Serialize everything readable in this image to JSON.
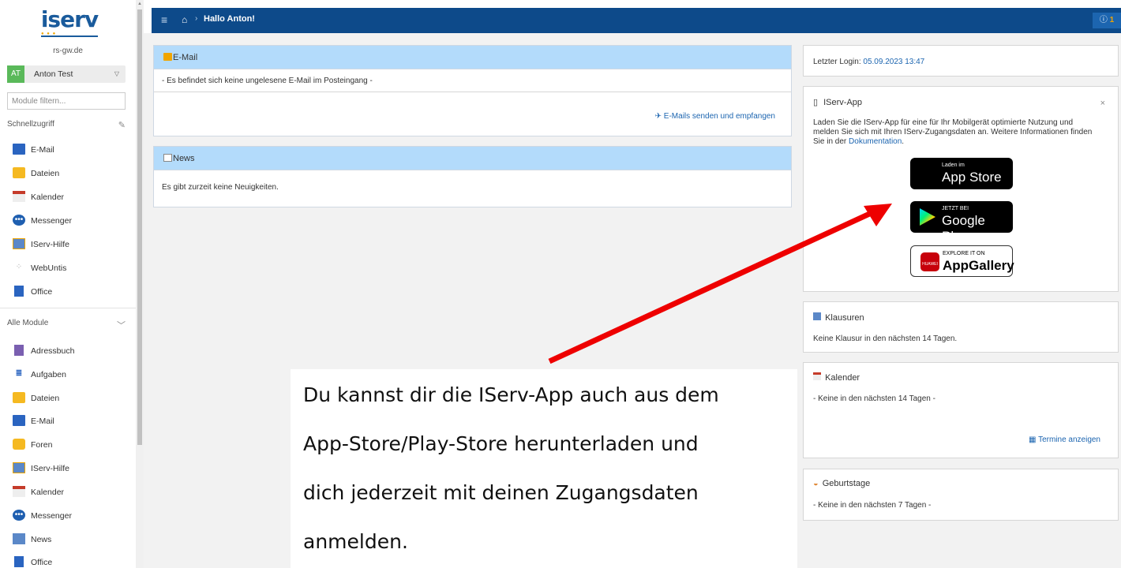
{
  "sidebar": {
    "logo": "iserv",
    "domain": "rs-gw.de",
    "user": {
      "initials": "AT",
      "name": "Anton Test"
    },
    "filter_placeholder": "Module filtern...",
    "quick_title": "Schnellzugriff",
    "quick_items": [
      {
        "label": "E-Mail",
        "icon": "mail-icon"
      },
      {
        "label": "Dateien",
        "icon": "folder-icon"
      },
      {
        "label": "Kalender",
        "icon": "calendar-icon"
      },
      {
        "label": "Messenger",
        "icon": "messenger-icon"
      },
      {
        "label": "IServ-Hilfe",
        "icon": "help-icon"
      },
      {
        "label": "WebUntis",
        "icon": "spinner-icon"
      },
      {
        "label": "Office",
        "icon": "office-icon"
      }
    ],
    "all_title": "Alle Module",
    "all_items": [
      {
        "label": "Adressbuch",
        "icon": "addressbook-icon"
      },
      {
        "label": "Aufgaben",
        "icon": "tasks-icon"
      },
      {
        "label": "Dateien",
        "icon": "folder-icon"
      },
      {
        "label": "E-Mail",
        "icon": "mail-icon"
      },
      {
        "label": "Foren",
        "icon": "forum-icon"
      },
      {
        "label": "IServ-Hilfe",
        "icon": "help-icon"
      },
      {
        "label": "Kalender",
        "icon": "calendar-icon"
      },
      {
        "label": "Messenger",
        "icon": "messenger-icon"
      },
      {
        "label": "News",
        "icon": "news-icon"
      },
      {
        "label": "Office",
        "icon": "office-icon"
      }
    ]
  },
  "topbar": {
    "greeting": "Hallo Anton!",
    "notification_count": "1"
  },
  "email_panel": {
    "title": "E-Mail",
    "empty": "- Es befindet sich keine ungelesene E-Mail im Posteingang -",
    "action": "E-Mails senden und empfangen"
  },
  "news_panel": {
    "title": "News",
    "empty": "Es gibt zurzeit keine Neuigkeiten."
  },
  "login": {
    "label": "Letzter Login:",
    "value": "05.09.2023 13:47"
  },
  "app_panel": {
    "title": "IServ-App",
    "text_line1": "Laden Sie die IServ-App für eine für Ihr Mobilgerät optimierte Nutzung und",
    "text_line2": "melden Sie sich mit Ihren IServ-Zugangsdaten an. Weitere Informationen finden",
    "text_line3": "Sie in der",
    "doc_link": "Dokumentation",
    "appstore_small": "Laden im",
    "appstore_big": "App Store",
    "play_small": "JETZT BEI",
    "play_big": "Google Play",
    "gallery_small": "EXPLORE IT ON",
    "gallery_big": "AppGallery",
    "gallery_brand": "HUAWEI"
  },
  "exams": {
    "title": "Klausuren",
    "text": "Keine Klausur in den nächsten 14 Tagen."
  },
  "calendar": {
    "title": "Kalender",
    "text": "- Keine in den nächsten 14 Tagen -",
    "action": "Termine anzeigen"
  },
  "birthdays": {
    "title": "Geburtstage",
    "text": "- Keine in den nächsten 7 Tagen -"
  },
  "overlay": {
    "line1": "Du kannst dir die IServ-App auch aus dem",
    "line2": "App-Store/Play-Store herunterladen und",
    "line3": "dich jederzeit mit deinen Zugangsdaten",
    "line4": "anmelden."
  },
  "colors": {
    "topbar": "#0d4a8a",
    "panel_header": "#b3dbfb",
    "link": "#1c65b0",
    "arrow": "#ee0000"
  }
}
